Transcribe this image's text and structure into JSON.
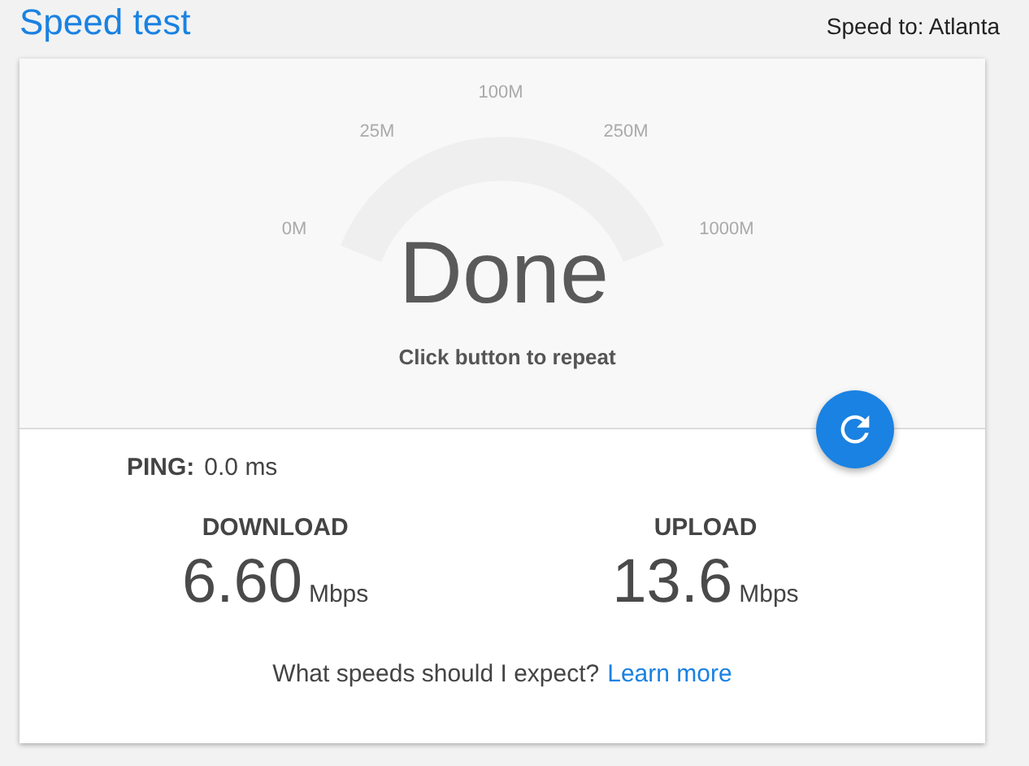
{
  "title": "Speed test",
  "server": "Speed to: Atlanta",
  "gauge": {
    "ticks": [
      "0M",
      "25M",
      "100M",
      "250M",
      "1000M"
    ],
    "status": "Done",
    "hint": "Click button to repeat"
  },
  "ping": {
    "label": "PING:",
    "value": "0.0 ms"
  },
  "results": [
    {
      "label": "DOWNLOAD",
      "value": "6.60",
      "unit": "Mbps"
    },
    {
      "label": "UPLOAD",
      "value": "13.6",
      "unit": "Mbps"
    }
  ],
  "footer": {
    "question": "What speeds should I expect?",
    "link": "Learn more"
  }
}
